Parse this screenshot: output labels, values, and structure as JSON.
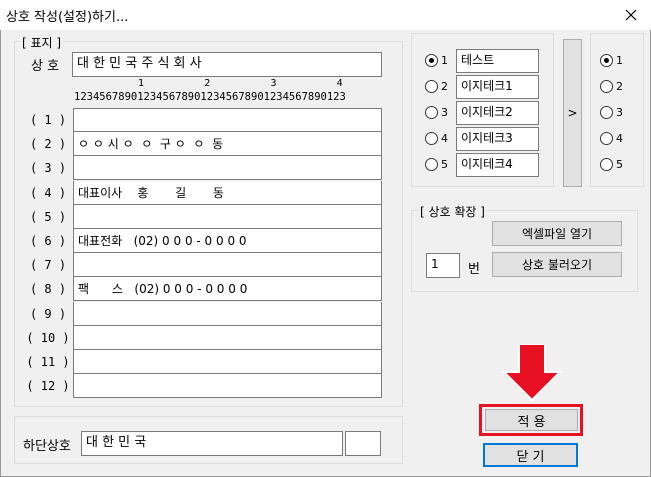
{
  "window": {
    "title": "상호 작성(설정)하기..."
  },
  "header_group": {
    "legend": "[ 표지 ]",
    "company_label": "상 호",
    "company_value": "대 한 민 국 주 식 회 사",
    "ruler_tens": "1          2          3          4",
    "ruler_units": "1234567890123456789012345678901234567890123",
    "rows": [
      {
        "label": "( 1 )",
        "value": ""
      },
      {
        "label": "( 2 )",
        "value": "ㅇ ㅇ 시 ㅇ  ㅇ  구 ㅇ  ㅇ  동"
      },
      {
        "label": "( 3 )",
        "value": ""
      },
      {
        "label": "( 4 )",
        "value": "대표이사    홍       길       동"
      },
      {
        "label": "( 5 )",
        "value": ""
      },
      {
        "label": "( 6 )",
        "value": "대표전화   (02) 0 0 0 - 0 0 0 0"
      },
      {
        "label": "( 7 )",
        "value": ""
      },
      {
        "label": "( 8 )",
        "value": "팩      스   (02) 0 0 0 - 0 0 0 0"
      },
      {
        "label": "( 9 )",
        "value": ""
      },
      {
        "label": "( 10 )",
        "value": ""
      },
      {
        "label": "( 11 )",
        "value": ""
      },
      {
        "label": "( 12 )",
        "value": ""
      }
    ]
  },
  "bottom_group": {
    "label": "하단상호",
    "value": "대 한 민 국",
    "extra_value": ""
  },
  "presets": {
    "items": [
      {
        "num": "1",
        "name": "테스트",
        "selected": true
      },
      {
        "num": "2",
        "name": "이지테크1",
        "selected": false
      },
      {
        "num": "3",
        "name": "이지테크2",
        "selected": false
      },
      {
        "num": "4",
        "name": "이지테크3",
        "selected": false
      },
      {
        "num": "5",
        "name": "이지테크4",
        "selected": false
      }
    ],
    "arrow_label": ">",
    "targets": [
      {
        "num": "1",
        "selected": true
      },
      {
        "num": "2",
        "selected": false
      },
      {
        "num": "3",
        "selected": false
      },
      {
        "num": "4",
        "selected": false
      },
      {
        "num": "5",
        "selected": false
      }
    ]
  },
  "extension": {
    "legend": "[ 상호 확장 ]",
    "open_excel_label": "엑셀파일 열기",
    "number_value": "1",
    "number_suffix": "번",
    "load_label": "상호 불러오기"
  },
  "actions": {
    "apply_label": "적 용",
    "close_label": "닫 기"
  },
  "colors": {
    "highlight": "#e81123",
    "focus_border": "#0078d7"
  }
}
